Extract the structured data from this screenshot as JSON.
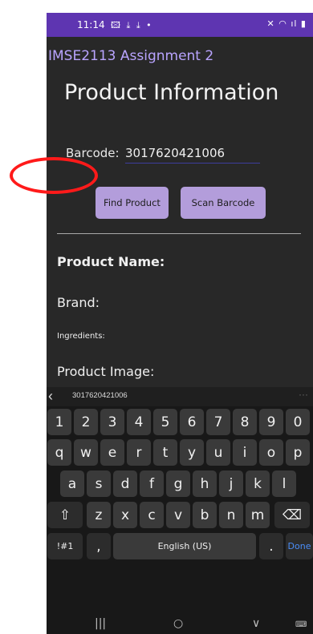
{
  "status": {
    "time": "11:14",
    "left_icons": "🖾 ⤓ ⤓ •",
    "right_icons": "✕ ◠ ıl ▮"
  },
  "appbar": {
    "title": "IMSE2113 Assignment 2"
  },
  "page": {
    "title": "Product Information",
    "barcode_label": "Barcode:",
    "barcode_value": "3017620421006",
    "find_button": "Find Product",
    "scan_button": "Scan Barcode",
    "product_name_label": "Product Name:",
    "brand_label": "Brand:",
    "ingredients_label": "Ingredients:",
    "image_label": "Product Image:"
  },
  "keyboard": {
    "suggestion": "3017620421006",
    "back_glyph": "‹",
    "more_glyph": "···",
    "row1": [
      "1",
      "2",
      "3",
      "4",
      "5",
      "6",
      "7",
      "8",
      "9",
      "0"
    ],
    "row2": [
      "q",
      "w",
      "e",
      "r",
      "t",
      "y",
      "u",
      "i",
      "o",
      "p"
    ],
    "row3": [
      "a",
      "s",
      "d",
      "f",
      "g",
      "h",
      "j",
      "k",
      "l"
    ],
    "row4": [
      "z",
      "x",
      "c",
      "v",
      "b",
      "n",
      "m"
    ],
    "shift": "⇧",
    "backspace": "⌫",
    "symbols": "!#1",
    "comma": ",",
    "space": "English (US)",
    "period": ".",
    "done": "Done"
  },
  "nav": {
    "recents": "|||",
    "home": "○",
    "back": "∨",
    "keyboard_switch": "⌨"
  },
  "colors": {
    "accent": "#5e35b1",
    "button": "#b39ddb",
    "annotation": "#ff1a1a"
  }
}
